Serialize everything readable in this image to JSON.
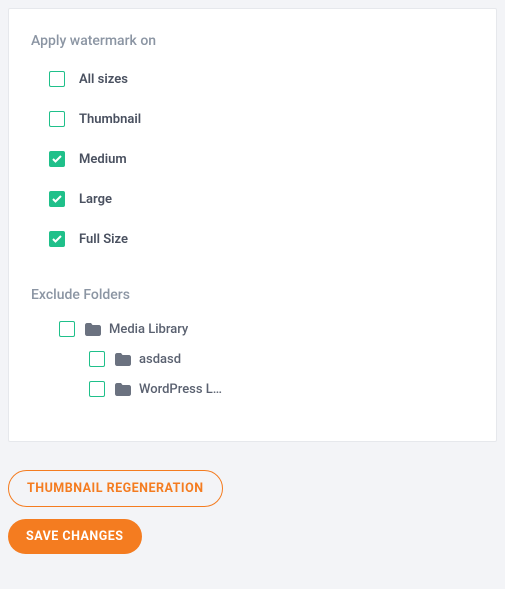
{
  "sections": {
    "watermark_title": "Apply watermark on",
    "exclude_title": "Exclude Folders"
  },
  "sizes": [
    {
      "label": "All sizes",
      "checked": false
    },
    {
      "label": "Thumbnail",
      "checked": false
    },
    {
      "label": "Medium",
      "checked": true
    },
    {
      "label": "Large",
      "checked": true
    },
    {
      "label": "Full Size",
      "checked": true
    }
  ],
  "folders": {
    "root": {
      "label": "Media Library",
      "checked": false
    },
    "children": [
      {
        "label": "asdasd",
        "checked": false
      },
      {
        "label": "WordPress L…",
        "checked": false
      }
    ]
  },
  "buttons": {
    "regen": "THUMBNAIL REGENERATION",
    "save": "SAVE CHANGES"
  },
  "colors": {
    "accent_green": "#1fc08a",
    "accent_orange": "#f47c20"
  }
}
